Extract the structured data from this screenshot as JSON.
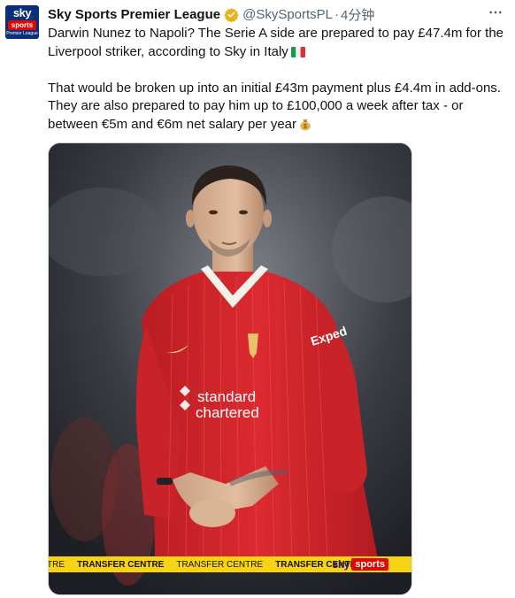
{
  "account": {
    "display_name": "Sky Sports Premier League",
    "handle": "@SkySportsPL",
    "separator": "·",
    "time": "4分钟",
    "avatar_line1": "sky",
    "avatar_line2": "sports",
    "avatar_line3": "Premier League"
  },
  "tweet": {
    "paragraph1": "Darwin Nunez to Napoli? The Serie A side are prepared to pay £47.4m for the Liverpool striker, according to Sky in Italy",
    "paragraph2": "That would be broken up into an initial £43m payment plus £4.4m in add-ons. They are also prepared to pay him up to £100,000 a week after tax - or between €5m and €6m net salary per year",
    "emoji1": "italy-flag",
    "emoji2": "money-bag"
  },
  "media": {
    "ticker": [
      "TRE",
      "TRANSFER CENTRE",
      "TRANSFER CENTRE",
      "TRANSFER CENTRE"
    ],
    "logo_left": "sky",
    "logo_right": "sports",
    "shirt_sponsor_1": "standard",
    "shirt_sponsor_2": "chartered",
    "sleeve_sponsor": "Exped"
  },
  "colors": {
    "verified": "#e8b21b",
    "ticker": "#f6d313",
    "sky_red": "#e10600",
    "shirt_red": "#d7262c"
  }
}
